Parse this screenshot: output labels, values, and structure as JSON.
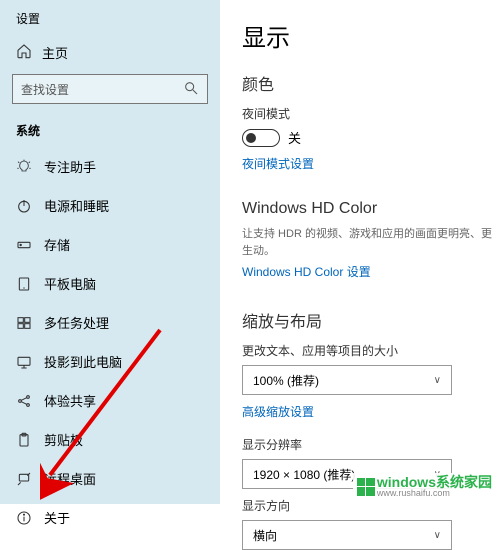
{
  "sidebar": {
    "settings_label": "设置",
    "home_label": "主页",
    "search_placeholder": "查找设置",
    "category": "系统",
    "items": [
      {
        "icon": "focus",
        "label": "专注助手"
      },
      {
        "icon": "power",
        "label": "电源和睡眠"
      },
      {
        "icon": "storage",
        "label": "存储"
      },
      {
        "icon": "tablet",
        "label": "平板电脑"
      },
      {
        "icon": "multitask",
        "label": "多任务处理"
      },
      {
        "icon": "project",
        "label": "投影到此电脑"
      },
      {
        "icon": "shared",
        "label": "体验共享"
      },
      {
        "icon": "clipboard",
        "label": "剪贴板"
      },
      {
        "icon": "remote",
        "label": "远程桌面"
      },
      {
        "icon": "about",
        "label": "关于"
      }
    ]
  },
  "main": {
    "title": "显示",
    "color_heading": "颜色",
    "night_label": "夜间模式",
    "toggle_state": "关",
    "night_link": "夜间模式设置",
    "hd_heading": "Windows HD Color",
    "hd_desc": "让支持 HDR 的视频、游戏和应用的画面更明亮、更生动。",
    "hd_link": "Windows HD Color 设置",
    "scale_heading": "缩放与布局",
    "scale_label": "更改文本、应用等项目的大小",
    "scale_value": "100% (推荐)",
    "adv_scale_link": "高级缩放设置",
    "res_label": "显示分辨率",
    "res_value": "1920 × 1080 (推荐)",
    "orient_label": "显示方向",
    "orient_value": "横向"
  },
  "watermark": {
    "main": "windows系统家园",
    "sub": "www.rushaifu.com"
  }
}
